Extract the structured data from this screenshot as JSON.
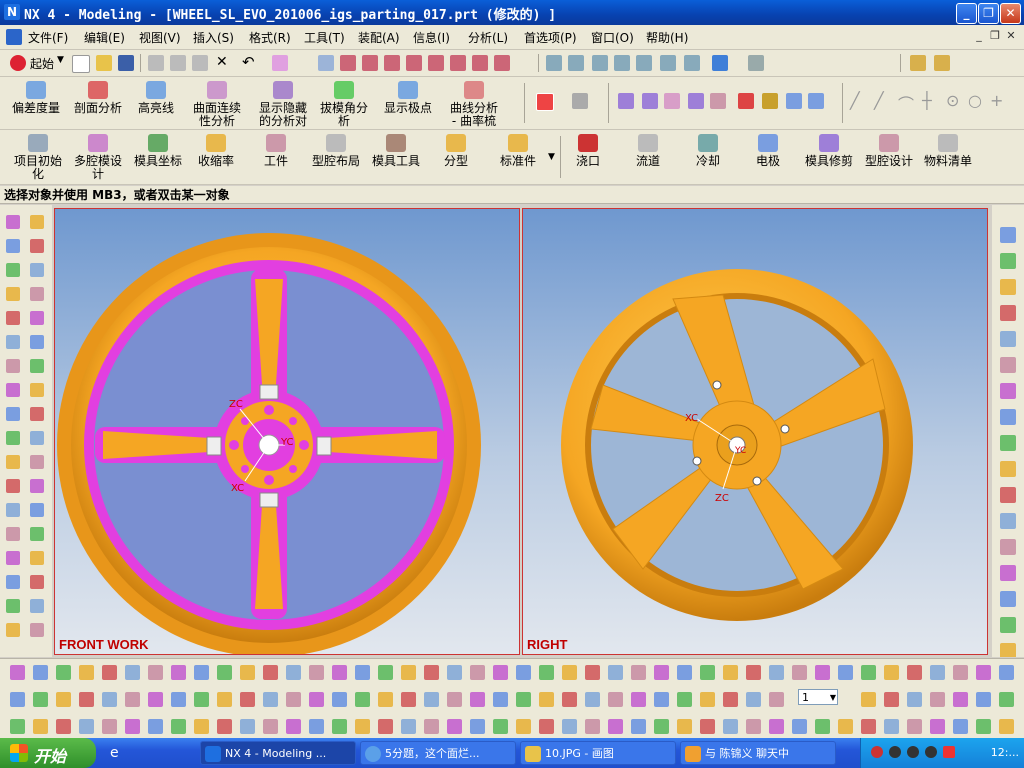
{
  "window": {
    "title": "NX 4 - Modeling - [WHEEL_SL_EVO_201006_igs_parting_017.prt  (修改的)  ]",
    "logo": "N"
  },
  "menu": [
    "文件(F)",
    "编辑(E)",
    "视图(V)",
    "插入(S)",
    "格式(R)",
    "工具(T)",
    "装配(A)",
    "信息(I)",
    "分析(L)",
    "首选项(P)",
    "窗口(O)",
    "帮助(H)"
  ],
  "toolbar1": {
    "start_label": "起始"
  },
  "analysis_buttons": [
    "偏差度量",
    "剖面分析",
    "高亮线",
    "曲面连续\n性分析",
    "显示隐藏\n的分析对",
    "拔模角分\n析",
    "显示极点",
    "曲线分析\n- 曲率梳"
  ],
  "mold_buttons": [
    "项目初始\n化",
    "多腔模设\n计",
    "模具坐标",
    "收缩率",
    "工件",
    "型腔布局",
    "模具工具",
    "分型",
    "标准件",
    "浇口",
    "流道",
    "冷却",
    "电极",
    "模具修剪",
    "型腔设计",
    "物料清单"
  ],
  "cue_line": "选择对象并使用 MB3，或者双击某一对象",
  "viewports": {
    "left": {
      "label": "FRONT WORK",
      "axis_zc": "ZC",
      "axis_yc": "YC",
      "axis_xc": "XC"
    },
    "right": {
      "label": "RIGHT",
      "axis_xc": "XC",
      "axis_zc": "ZC",
      "axis_yc": "YC"
    }
  },
  "bottom": {
    "layer_value": "1"
  },
  "taskbar": {
    "start_label": "开始",
    "tasks": [
      "NX 4 - Modeling ...",
      "5分题，这个面烂...",
      "10.JPG - 画图",
      "与 陈锦义 聊天中"
    ],
    "clock": "12:..."
  },
  "colors": {
    "wheel_orange": "#f5a623",
    "parting_magenta": "#e23fe0",
    "viewport_border": "#cc3333",
    "label_red": "#c00000"
  }
}
